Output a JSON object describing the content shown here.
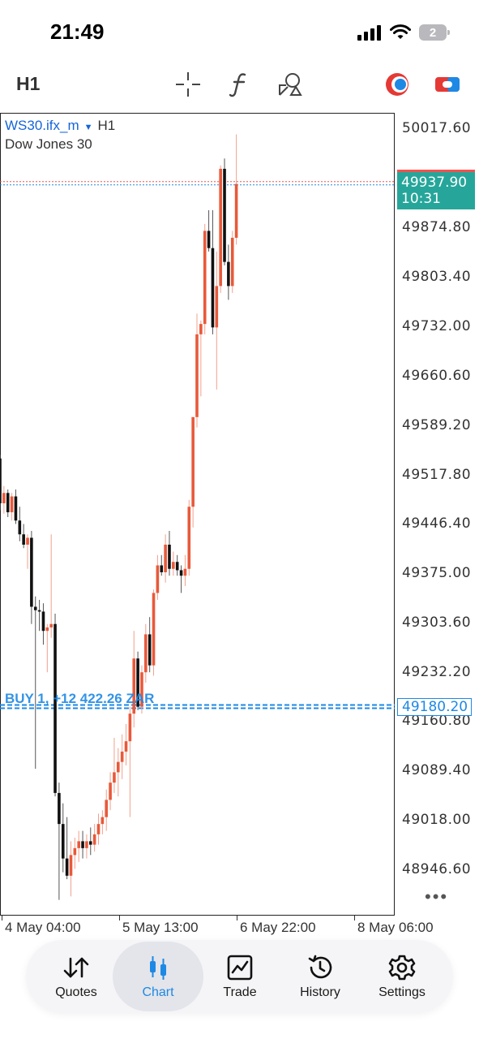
{
  "status": {
    "time": "21:49",
    "battery": "2"
  },
  "toolbar": {
    "timeframe": "H1"
  },
  "chart_header": {
    "symbol": "WS30.ifx_m",
    "timeframe": "H1",
    "description": "Dow Jones 30"
  },
  "price_axis": [
    "50017.60",
    "49874.80",
    "49803.40",
    "49732.00",
    "49660.60",
    "49589.20",
    "49517.80",
    "49446.40",
    "49375.00",
    "49303.60",
    "49232.20",
    "49160.80",
    "49089.40",
    "49018.00",
    "48946.60"
  ],
  "current_price": {
    "value": "49937.90",
    "countdown": "10:31"
  },
  "position": {
    "label": "BUY 1, +12 422.26 ZAR",
    "price": "49180.20"
  },
  "time_axis": [
    "4 May 04:00",
    "5 May 13:00",
    "6 May 22:00",
    "8 May 06:00"
  ],
  "more_label": "•••",
  "nav": [
    {
      "label": "Quotes"
    },
    {
      "label": "Chart"
    },
    {
      "label": "Trade"
    },
    {
      "label": "History"
    },
    {
      "label": "Settings"
    }
  ],
  "colors": {
    "accent": "#1e88e5",
    "bull": "#e8593a",
    "bear": "#111111",
    "price_tag": "#26a69a"
  },
  "chart_data": {
    "type": "candlestick",
    "symbol": "WS30.ifx_m",
    "timeframe": "H1",
    "ylim": [
      48900,
      50030
    ],
    "candles": [
      {
        "o": 49540,
        "h": 49545,
        "l": 49465,
        "c": 49475
      },
      {
        "o": 49475,
        "h": 49500,
        "l": 49460,
        "c": 49490
      },
      {
        "o": 49490,
        "h": 49495,
        "l": 49455,
        "c": 49462
      },
      {
        "o": 49462,
        "h": 49490,
        "l": 49450,
        "c": 49485
      },
      {
        "o": 49485,
        "h": 49495,
        "l": 49445,
        "c": 49450
      },
      {
        "o": 49450,
        "h": 49470,
        "l": 49420,
        "c": 49430
      },
      {
        "o": 49430,
        "h": 49445,
        "l": 49410,
        "c": 49415
      },
      {
        "o": 49415,
        "h": 49430,
        "l": 49380,
        "c": 49425
      },
      {
        "o": 49425,
        "h": 49435,
        "l": 49300,
        "c": 49325
      },
      {
        "o": 49325,
        "h": 49340,
        "l": 49090,
        "c": 49320
      },
      {
        "o": 49320,
        "h": 49335,
        "l": 49290,
        "c": 49318
      },
      {
        "o": 49318,
        "h": 49330,
        "l": 49270,
        "c": 49290
      },
      {
        "o": 49290,
        "h": 49300,
        "l": 49230,
        "c": 49295
      },
      {
        "o": 49295,
        "h": 49430,
        "l": 49280,
        "c": 49300
      },
      {
        "o": 49300,
        "h": 49315,
        "l": 49050,
        "c": 49055
      },
      {
        "o": 49055,
        "h": 49070,
        "l": 48900,
        "c": 49010
      },
      {
        "o": 49010,
        "h": 49040,
        "l": 48940,
        "c": 48960
      },
      {
        "o": 48960,
        "h": 49020,
        "l": 48930,
        "c": 48935
      },
      {
        "o": 48935,
        "h": 48985,
        "l": 48905,
        "c": 48965
      },
      {
        "o": 48965,
        "h": 48990,
        "l": 48945,
        "c": 48975
      },
      {
        "o": 48975,
        "h": 49000,
        "l": 48955,
        "c": 48985
      },
      {
        "o": 48985,
        "h": 49000,
        "l": 48960,
        "c": 48975
      },
      {
        "o": 48975,
        "h": 48995,
        "l": 48960,
        "c": 48985
      },
      {
        "o": 48985,
        "h": 49005,
        "l": 48965,
        "c": 48980
      },
      {
        "o": 48980,
        "h": 49010,
        "l": 48970,
        "c": 48995
      },
      {
        "o": 48995,
        "h": 49025,
        "l": 48980,
        "c": 49010
      },
      {
        "o": 49010,
        "h": 49030,
        "l": 48995,
        "c": 49020
      },
      {
        "o": 49020,
        "h": 49060,
        "l": 49000,
        "c": 49045
      },
      {
        "o": 49045,
        "h": 49085,
        "l": 49030,
        "c": 49070
      },
      {
        "o": 49070,
        "h": 49135,
        "l": 49055,
        "c": 49085
      },
      {
        "o": 49085,
        "h": 49120,
        "l": 49050,
        "c": 49100
      },
      {
        "o": 49100,
        "h": 49140,
        "l": 49075,
        "c": 49115
      },
      {
        "o": 49115,
        "h": 49155,
        "l": 49095,
        "c": 49130
      },
      {
        "o": 49130,
        "h": 49180,
        "l": 49020,
        "c": 49170
      },
      {
        "o": 49170,
        "h": 49290,
        "l": 49150,
        "c": 49250
      },
      {
        "o": 49250,
        "h": 49260,
        "l": 49175,
        "c": 49180
      },
      {
        "o": 49180,
        "h": 49240,
        "l": 49170,
        "c": 49230
      },
      {
        "o": 49230,
        "h": 49300,
        "l": 49215,
        "c": 49285
      },
      {
        "o": 49285,
        "h": 49310,
        "l": 49230,
        "c": 49240
      },
      {
        "o": 49240,
        "h": 49350,
        "l": 49225,
        "c": 49345
      },
      {
        "o": 49345,
        "h": 49400,
        "l": 49335,
        "c": 49385
      },
      {
        "o": 49385,
        "h": 49400,
        "l": 49370,
        "c": 49375
      },
      {
        "o": 49375,
        "h": 49430,
        "l": 49360,
        "c": 49415
      },
      {
        "o": 49415,
        "h": 49435,
        "l": 49370,
        "c": 49380
      },
      {
        "o": 49380,
        "h": 49405,
        "l": 49370,
        "c": 49390
      },
      {
        "o": 49390,
        "h": 49400,
        "l": 49370,
        "c": 49378
      },
      {
        "o": 49378,
        "h": 49385,
        "l": 49345,
        "c": 49370
      },
      {
        "o": 49370,
        "h": 49400,
        "l": 49355,
        "c": 49380
      },
      {
        "o": 49380,
        "h": 49480,
        "l": 49370,
        "c": 49470
      },
      {
        "o": 49470,
        "h": 49580,
        "l": 49440,
        "c": 49600
      },
      {
        "o": 49600,
        "h": 49750,
        "l": 49585,
        "c": 49720
      },
      {
        "o": 49720,
        "h": 49740,
        "l": 49630,
        "c": 49735
      },
      {
        "o": 49735,
        "h": 49880,
        "l": 49720,
        "c": 49870
      },
      {
        "o": 49870,
        "h": 49900,
        "l": 49840,
        "c": 49845
      },
      {
        "o": 49845,
        "h": 49900,
        "l": 49720,
        "c": 49730
      },
      {
        "o": 49730,
        "h": 49840,
        "l": 49640,
        "c": 49790
      },
      {
        "o": 49790,
        "h": 49965,
        "l": 49780,
        "c": 49960
      },
      {
        "o": 49960,
        "h": 49975,
        "l": 49820,
        "c": 49825
      },
      {
        "o": 49825,
        "h": 49850,
        "l": 49770,
        "c": 49790
      },
      {
        "o": 49790,
        "h": 49870,
        "l": 49780,
        "c": 49860
      },
      {
        "o": 49860,
        "h": 50010,
        "l": 49850,
        "c": 49938
      }
    ]
  }
}
